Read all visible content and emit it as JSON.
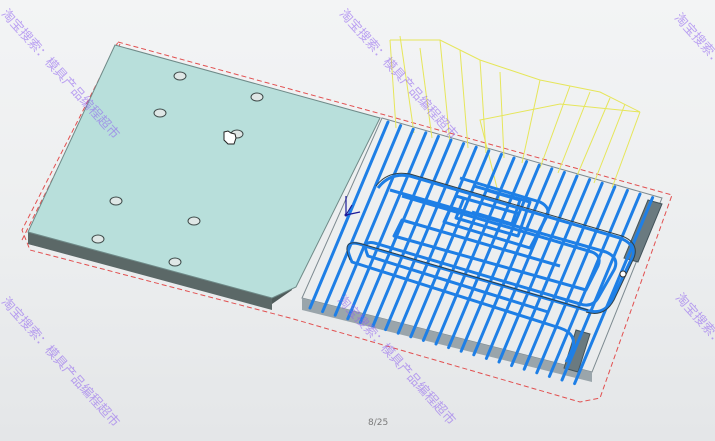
{
  "page_indicator": "8/25",
  "watermark_text": "淘宝搜索：模具产品编程超市",
  "colors": {
    "plate_top": "#b6dfdc",
    "plate_side": "#53605f",
    "toolpath": "#1e7fe6",
    "rapid_moves": "#e6e65a",
    "bbox": "#e25050",
    "background": "#eef0f1",
    "watermark": "#8e5ff0"
  },
  "icons": [
    "axis-triad-icon",
    "hand-cursor-icon"
  ]
}
